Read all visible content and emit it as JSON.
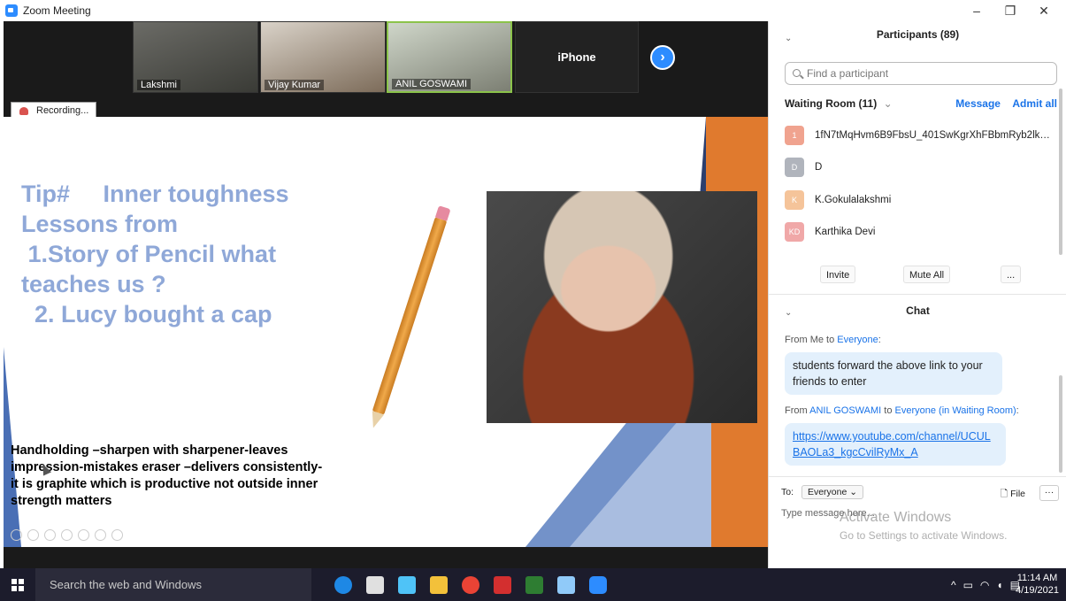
{
  "window": {
    "title": "Zoom Meeting",
    "min": "–",
    "restore": "❐",
    "close": "✕"
  },
  "video": {
    "tiles": [
      {
        "name": "Lakshmi"
      },
      {
        "name": "Vijay Kumar"
      },
      {
        "name": "ANIL GOSWAMI"
      },
      {
        "name": "iPhone"
      }
    ],
    "next": "›",
    "recording": "Recording..."
  },
  "slide": {
    "lines": [
      "Tip#     Inner toughness",
      "Lessons from",
      " 1.Story of Pencil what",
      "teaches us ?",
      "  2. Lucy bought a cap"
    ],
    "body": "Handholding –sharpen with sharpener-leaves impression-mistakes eraser –delivers consistently-it is graphite which is productive not outside inner strength  matters"
  },
  "participants": {
    "title": "Participants (89)",
    "search_placeholder": "Find a participant",
    "waiting_room": "Waiting Room (11)",
    "message": "Message",
    "admit_all": "Admit all",
    "items": [
      {
        "initial": "1",
        "name": "1fN7tMqHvm6B9FbsU_401SwKgrXhFBbmRyb2lkU2h...",
        "color": "#f0a38f"
      },
      {
        "initial": "D",
        "name": "D",
        "color": "#b0b4bc"
      },
      {
        "initial": "K",
        "name": "K.Gokulalakshmi",
        "color": "#f5c49a"
      },
      {
        "initial": "KD",
        "name": "Karthika Devi",
        "color": "#f0a8a8"
      }
    ],
    "invite": "Invite",
    "mute_all": "Mute All",
    "more": "..."
  },
  "chat": {
    "title": "Chat",
    "msg1_from_prefix": "From Me to ",
    "msg1_to": "Everyone",
    "msg1_suffix": ":",
    "msg1_text": "students forward the above link to your friends to enter",
    "msg2_from_prefix": "From ",
    "msg2_sender": "ANIL GOSWAMI",
    "msg2_mid": " to ",
    "msg2_to": "Everyone (in Waiting Room)",
    "msg2_suffix": ":",
    "msg2_link": "https://www.youtube.com/channel/UCULBAOLa3_kgcCvilRyMx_A",
    "to_label": "To:",
    "to_value": "Everyone ⌄",
    "file": "File",
    "more": "···",
    "input_placeholder": "Type message here..."
  },
  "watermark": {
    "line1": "Activate Windows",
    "line2": "Go to Settings to activate Windows."
  },
  "taskbar": {
    "search": "Search the web and Windows",
    "icons": [
      {
        "name": "edge",
        "color": "#1e88e5"
      },
      {
        "name": "store",
        "color": "#e0e0e0"
      },
      {
        "name": "photos",
        "color": "#4fc3f7"
      },
      {
        "name": "file-explorer",
        "color": "#f3c13a"
      },
      {
        "name": "chrome",
        "color": "#ea4335"
      },
      {
        "name": "acrobat",
        "color": "#d32f2f"
      },
      {
        "name": "excel",
        "color": "#2e7d32"
      },
      {
        "name": "notepad",
        "color": "#90caf9"
      },
      {
        "name": "zoom",
        "color": "#2d8cff"
      }
    ],
    "tray": "^",
    "time": "11:14 AM",
    "date": "4/19/2021"
  }
}
